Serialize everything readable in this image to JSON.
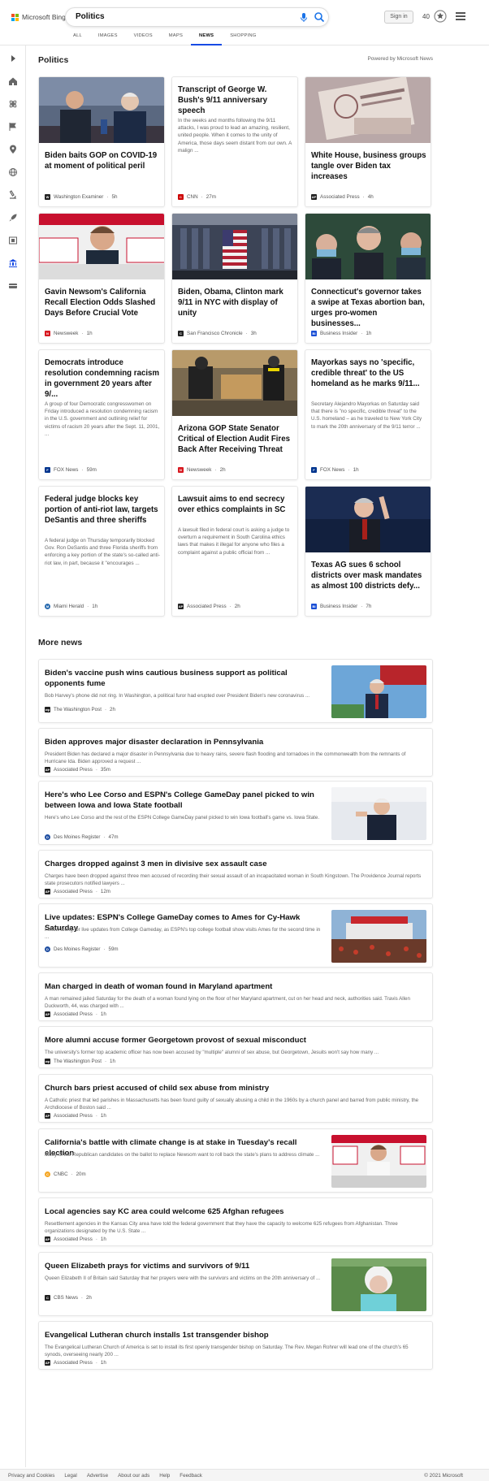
{
  "header": {
    "brand": "Microsoft Bing",
    "search_value": "Politics",
    "sign_in": "Sign in",
    "points": "40",
    "tabs": [
      {
        "label": "ALL"
      },
      {
        "label": "IMAGES"
      },
      {
        "label": "VIDEOS"
      },
      {
        "label": "MAPS"
      },
      {
        "label": "NEWS",
        "active": true
      },
      {
        "label": "SHOPPING"
      }
    ]
  },
  "section": {
    "title": "Politics",
    "powered": "Powered by Microsoft News"
  },
  "cards": [
    {
      "title": "Biden baits GOP on COVID-19 at moment of political peril",
      "source": "Washington Examiner",
      "time": "5h",
      "src_color": "#222",
      "src_letter": "W"
    },
    {
      "title": "Transcript of George W. Bush's 9/11 anniversary speech",
      "snippet": "In the weeks and months following the 9/11 attacks, I was proud to lead an amazing, resilient, united people. When it comes to the unity of America, those days seem distant from our own. A malign ...",
      "source": "CNN",
      "time": "27m",
      "src_color": "#cc0000",
      "src_letter": "CNN"
    },
    {
      "title": "White House, business groups tangle over Biden tax increases",
      "source": "Associated Press",
      "time": "4h",
      "src_color": "#222",
      "src_letter": "AP"
    },
    {
      "title": "Gavin Newsom's California Recall Election Odds Slashed Days Before Crucial Vote",
      "source": "Newsweek",
      "time": "1h",
      "src_color": "#d71920",
      "src_letter": "N"
    },
    {
      "title": "Biden, Obama, Clinton mark 9/11 in NYC with display of unity",
      "source": "San Francisco Chronicle",
      "time": "3h",
      "src_color": "#222",
      "src_letter": "C"
    },
    {
      "title": "Connecticut's governor takes a swipe at Texas abortion ban, urges pro-women businesses...",
      "source": "Business Insider",
      "time": "1h",
      "src_color": "#1a4fd6",
      "src_letter": "BI"
    },
    {
      "title": "Democrats introduce resolution condemning racism in government 20 years after 9/...",
      "snippet": "A group of four Democratic congresswomen on Friday introduced a resolution condemning racism in the U.S. government and outlining relief for victims of racism 20 years after the Sept. 11, 2001, ...",
      "source": "FOX News",
      "time": "59m",
      "src_color": "#00358e",
      "src_letter": "F"
    },
    {
      "title": "Arizona GOP State Senator Critical of Election Audit Fires Back After Receiving Threat",
      "source": "Newsweek",
      "time": "2h",
      "src_color": "#d71920",
      "src_letter": "N"
    },
    {
      "title": "Mayorkas says no 'specific, credible threat' to the US homeland as he marks 9/11...",
      "snippet": "Secretary Alejandro Mayorkas on Saturday said that there is \"no specific, credible threat\" to the U.S. homeland – as he traveled to New York City to mark the 20th anniversary of the 9/11 terror ...",
      "source": "FOX News",
      "time": "1h",
      "src_color": "#00358e",
      "src_letter": "F"
    },
    {
      "title": "Federal judge blocks key portion of anti-riot law, targets DeSantis and three sheriffs",
      "snippet": "A federal judge on Thursday temporarily blocked Gov. Ron DeSantis and three Florida sheriffs from enforcing a key portion of the state's so-called anti-riot law, in part, because it \"encourages ...",
      "source": "Miami Herald",
      "time": "1h",
      "src_color": "#2b6cb0",
      "src_letter": "M"
    },
    {
      "title": "Lawsuit aims to end secrecy over ethics complaints in SC",
      "snippet": "A lawsuit filed in federal court is asking a judge to overturn a requirement in South Carolina ethics laws that makes it illegal for anyone who files a complaint against a public official from ...",
      "source": "Associated Press",
      "time": "2h",
      "src_color": "#222",
      "src_letter": "AP"
    },
    {
      "title": "Texas AG sues 6 school districts over mask mandates as almost 100 districts defy...",
      "source": "Business Insider",
      "time": "7h",
      "src_color": "#1a4fd6",
      "src_letter": "BI"
    }
  ],
  "more_news": {
    "title": "More news",
    "items": [
      {
        "title": "Biden's vaccine push wins cautious business support as political opponents fume",
        "snippet": "Bob Harvey's phone did not ring. In Washington, a political furor had erupted over President Biden's new coronavirus ...",
        "source": "The Washington Post",
        "time": "2h",
        "src_color": "#222",
        "src_letter": "wp",
        "image": true
      },
      {
        "title": "Biden approves major disaster declaration in Pennsylvania",
        "snippet": "President Biden has declared a major disaster in Pennsylvania due to heavy rains, severe flash flooding and tornadoes in the commonwealth from the remnants of Hurricane Ida. Biden approved a request ...",
        "source": "Associated Press",
        "time": "35m",
        "src_color": "#222",
        "src_letter": "AP",
        "image": false
      },
      {
        "title": "Here's who Lee Corso and ESPN's College GameDay panel picked to win between Iowa and Iowa State football",
        "snippet": "Here's who Lee Corso and the rest of the ESPN College GameDay panel picked to win Iowa football's game vs. Iowa State.",
        "source": "Des Moines Register",
        "time": "47m",
        "src_color": "#1f4ea1",
        "src_letter": "D",
        "image": true
      },
      {
        "title": "Charges dropped against 3 men in divisive sex assault case",
        "snippet": "Charges have been dropped against three men accused of recording their sexual assault of an incapacitated woman in South Kingstown. The Providence Journal reports state prosecutors notified lawyers ...",
        "source": "Associated Press",
        "time": "12m",
        "src_color": "#222",
        "src_letter": "AP",
        "image": false
      },
      {
        "title": "Live updates: ESPN's College GameDay comes to Ames for Cy-Hawk Saturday",
        "snippet": "Follow along for live updates from College Gameday, as ESPN's top college football show visits Ames for the second time in ...",
        "source": "Des Moines Register",
        "time": "59m",
        "src_color": "#1f4ea1",
        "src_letter": "D",
        "image": true
      },
      {
        "title": "Man charged in death of woman found in Maryland apartment",
        "snippet": "A man remained jailed Saturday for the death of a woman found lying on the floor of her Maryland apartment, cut on her head and neck, authorities said. Travis Allen Duckworth, 44, was charged with ...",
        "source": "Associated Press",
        "time": "1h",
        "src_color": "#222",
        "src_letter": "AP",
        "image": false
      },
      {
        "title": "More alumni accuse former Georgetown provost of sexual misconduct",
        "snippet": "The university's former top academic officer has now been accused by \"multiple\" alumni of sex abuse, but Georgetown, Jesuits won't say how many ...",
        "source": "The Washington Post",
        "time": "1h",
        "src_color": "#222",
        "src_letter": "wp",
        "image": false
      },
      {
        "title": "Church bars priest accused of child sex abuse from ministry",
        "snippet": "A Catholic priest that led parishes in Massachusetts has been found guilty of sexually abusing a child in the 1960s by a church panel and barred from public ministry, the Archdiocese of Boston said ...",
        "source": "Associated Press",
        "time": "1h",
        "src_color": "#222",
        "src_letter": "AP",
        "image": false
      },
      {
        "title": "California's battle with climate change is at stake in Tuesday's recall election",
        "snippet": "Many of the Republican candidates on the ballot to replace Newsom want to roll back the state's plans to address climate ...",
        "source": "CNBC",
        "time": "20m",
        "src_color": "#f5a623",
        "src_letter": "C",
        "image": true
      },
      {
        "title": "Local agencies say KC area could welcome 625 Afghan refugees",
        "snippet": "Resettlement agencies in the Kansas City area have told the federal government that they have the capacity to welcome 625 refugees from Afghanistan. Three organizations designated by the U.S. State ...",
        "source": "Associated Press",
        "time": "1h",
        "src_color": "#222",
        "src_letter": "AP",
        "image": false
      },
      {
        "title": "Queen Elizabeth prays for victims and survivors of 9/11",
        "snippet": "Queen Elizabeth II of Britain said Saturday that her prayers were with the survivors and victims on the 20th anniversary of ...",
        "source": "CBS News",
        "time": "2h",
        "src_color": "#222",
        "src_letter": "C",
        "image": true
      },
      {
        "title": "Evangelical Lutheran church installs 1st transgender bishop",
        "snippet": "The Evangelical Lutheran Church of America is set to install its first openly transgender bishop on Saturday. The Rev. Megan Rohrer will lead one of the church's 65 synods, overseeing nearly 200 ...",
        "source": "Associated Press",
        "time": "1h",
        "src_color": "#222",
        "src_letter": "AP",
        "image": false
      }
    ]
  },
  "footer": {
    "links": [
      "Privacy and Cookies",
      "Legal",
      "Advertise",
      "About our ads",
      "Help",
      "Feedback"
    ],
    "copyright": "© 2021 Microsoft"
  }
}
